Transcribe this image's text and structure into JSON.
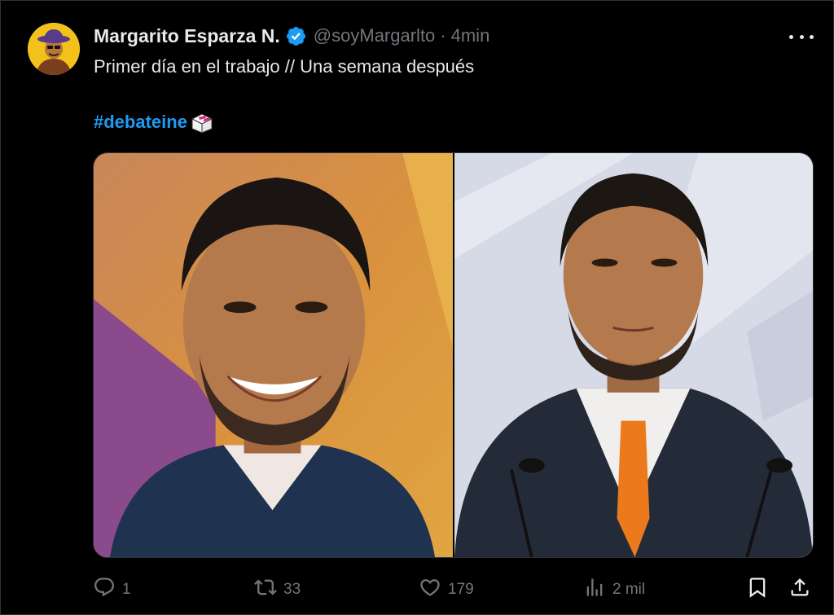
{
  "author": {
    "name": "Margarito Esparza N.",
    "handle": "@soyMargarlto",
    "separator": "·",
    "time": "4min"
  },
  "tweet": {
    "text": "Primer día en el trabajo // Una semana después",
    "hashtag": "#debateine"
  },
  "media": {
    "left_photo": "smiling-man-blue-suit",
    "right_photo": "serious-man-orange-tie"
  },
  "actions": {
    "replies": "1",
    "retweets": "33",
    "likes": "179",
    "views": "2 mil"
  },
  "colors": {
    "background": "#000000",
    "text": "#e7e9ea",
    "muted": "#71767b",
    "accent": "#1d9bf0",
    "verified": "#1d9bf0"
  },
  "icons": [
    "more-icon",
    "verified-icon",
    "reply-icon",
    "retweet-icon",
    "like-icon",
    "views-icon",
    "bookmark-icon",
    "share-icon"
  ]
}
